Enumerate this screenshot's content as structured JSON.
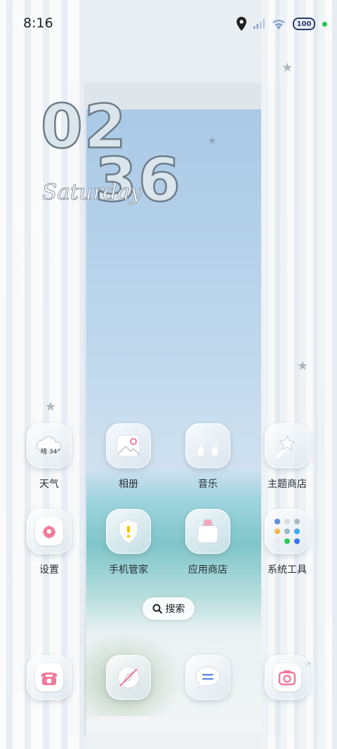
{
  "status_bar": {
    "time": "8:16",
    "battery": "100",
    "icons": [
      "location-icon",
      "signal-icon",
      "wifi-icon",
      "battery-icon",
      "privacy-dot-icon"
    ]
  },
  "clock": {
    "hours": "02",
    "minutes": "36",
    "day": "Saturday"
  },
  "apps": {
    "row1": [
      {
        "label": "天气",
        "icon": "weather-icon",
        "badge": "晴 34°"
      },
      {
        "label": "相册",
        "icon": "gallery-icon"
      },
      {
        "label": "音乐",
        "icon": "headphones-icon"
      },
      {
        "label": "主题商店",
        "icon": "theme-brush-icon"
      }
    ],
    "row2": [
      {
        "label": "设置",
        "icon": "gear-icon"
      },
      {
        "label": "手机管家",
        "icon": "shield-icon"
      },
      {
        "label": "应用商店",
        "icon": "shopping-bag-icon"
      },
      {
        "label": "系统工具",
        "icon": "folder-icon"
      }
    ]
  },
  "search": {
    "label": "搜索",
    "icon": "search-icon"
  },
  "dock": [
    {
      "icon": "phone-icon"
    },
    {
      "icon": "browser-compass-icon"
    },
    {
      "icon": "message-icon"
    },
    {
      "icon": "camera-icon"
    }
  ],
  "colors": {
    "accent_pink": "#f07a9a",
    "accent_yellow": "#f5c400",
    "glass": "#e6edf2"
  }
}
